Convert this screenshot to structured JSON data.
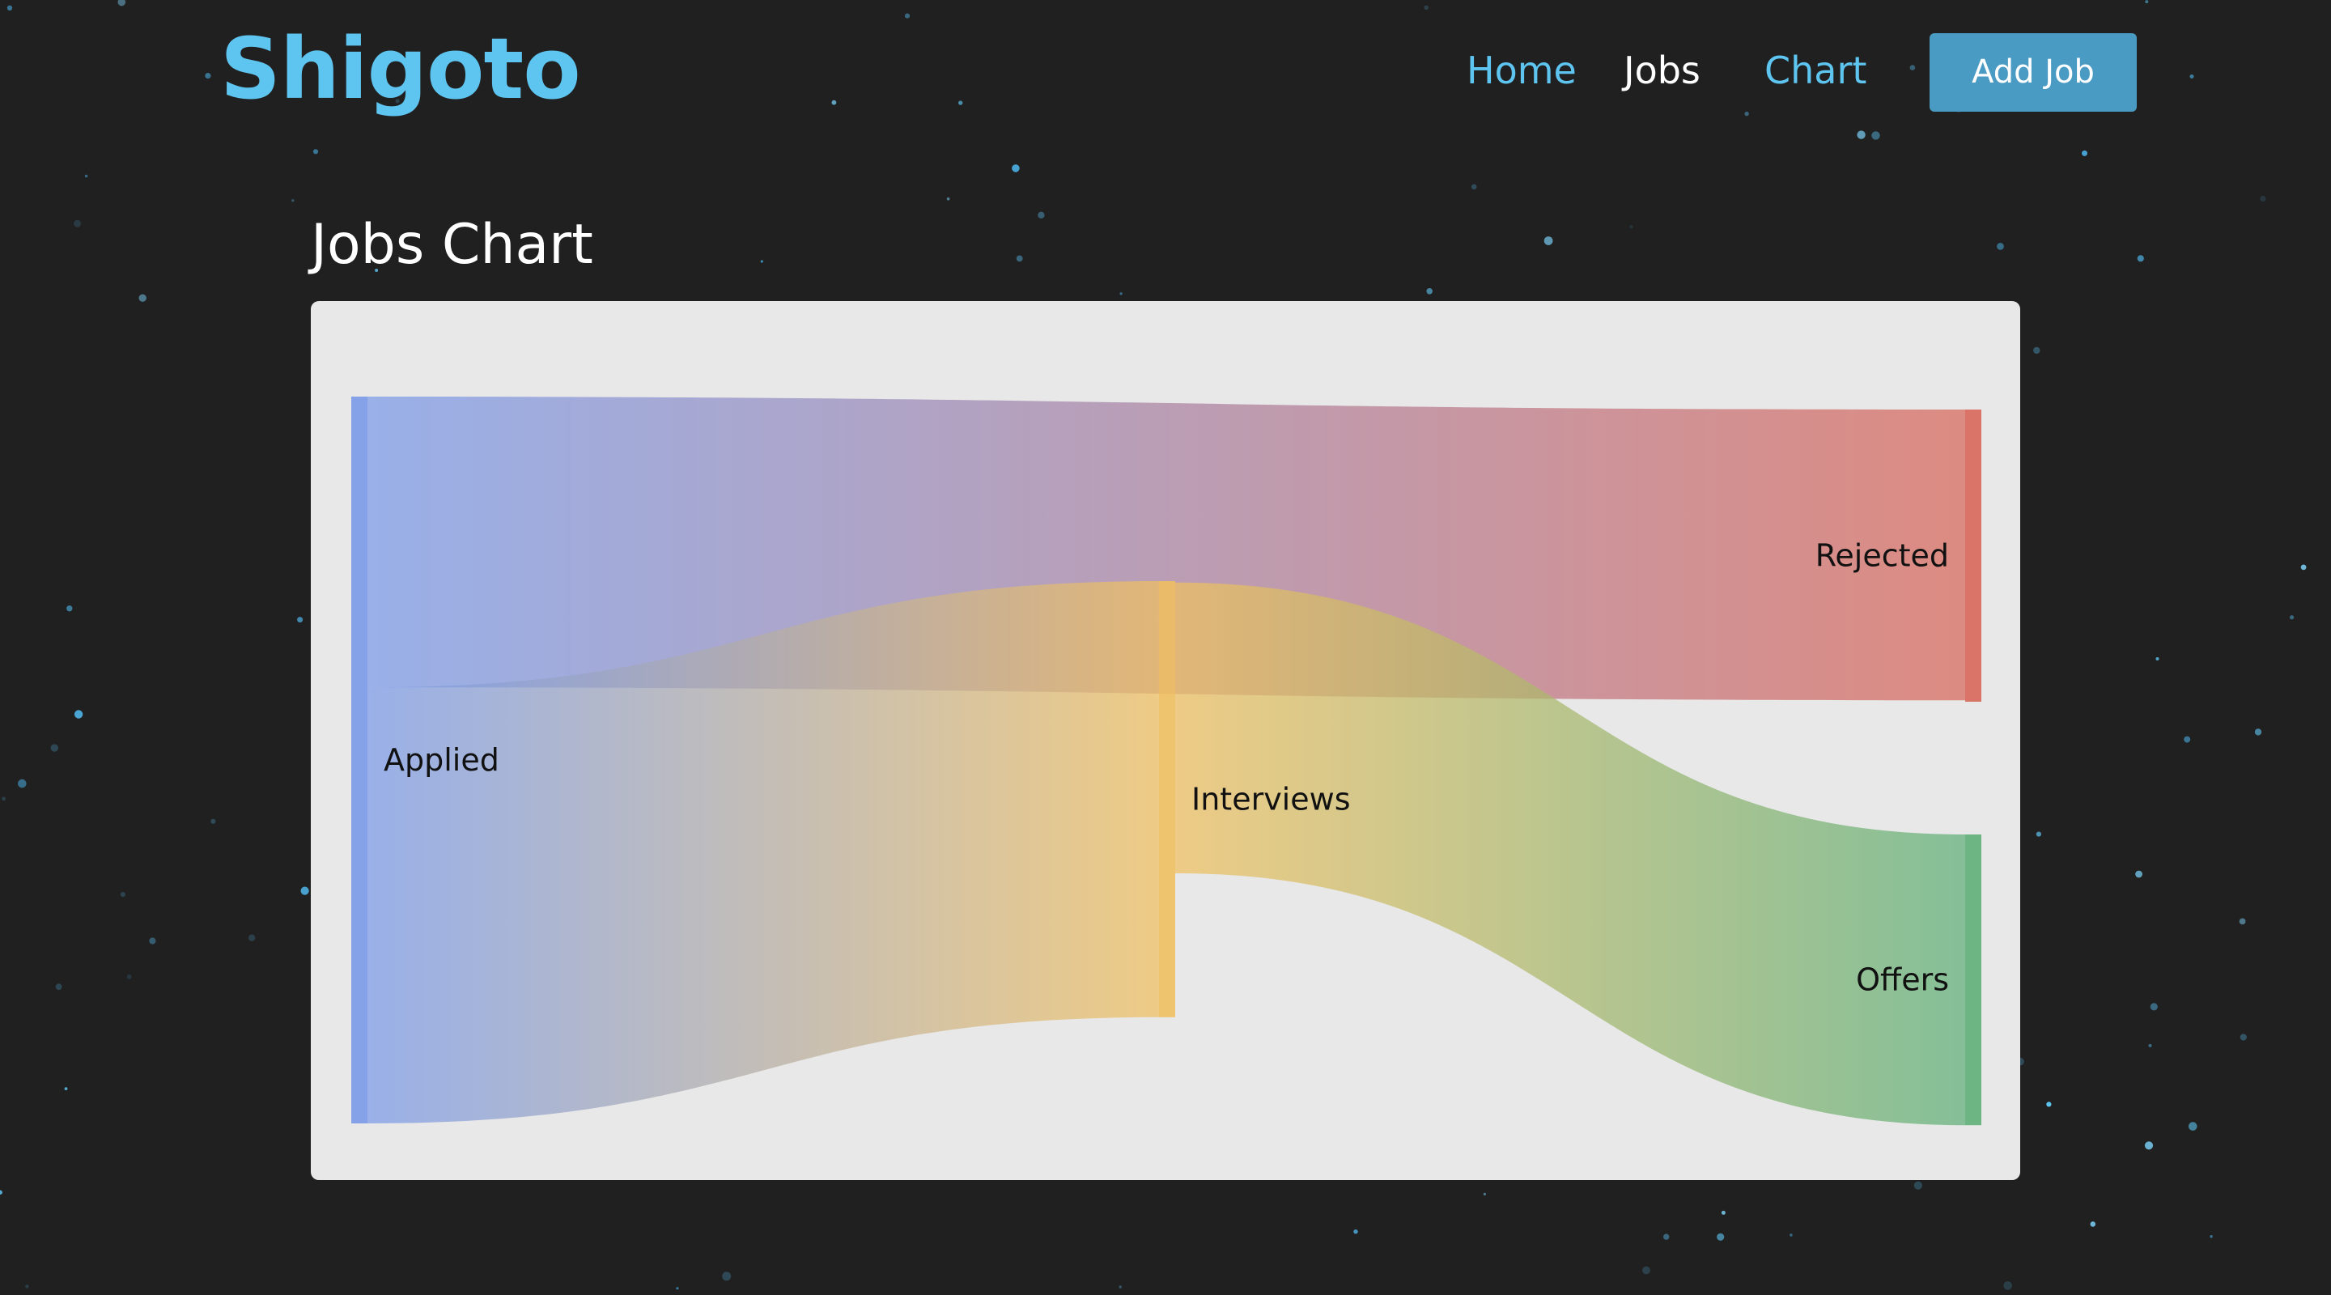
{
  "app": {
    "logo": "Shigoto"
  },
  "nav": {
    "home": "Home",
    "jobs": "Jobs",
    "chart": "Chart",
    "add_job": "Add Job"
  },
  "page": {
    "title": "Jobs Chart"
  },
  "colors": {
    "background": "#202020",
    "accent": "#5ec4f0",
    "button": "#4a9bc4",
    "card": "#e8e8e8",
    "applied": "#7a9ae8",
    "interviews": "#f0c060",
    "rejected": "#d8675a",
    "offers": "#5faf78"
  },
  "chart_data": {
    "type": "sankey",
    "title": "",
    "nodes": [
      {
        "id": "applied",
        "name": "Applied",
        "color": "#7a9ae8",
        "column": 0
      },
      {
        "id": "interviews",
        "name": "Interviews",
        "color": "#f0c060",
        "column": 1
      },
      {
        "id": "rejected",
        "name": "Rejected",
        "color": "#d8675a",
        "column": 2
      },
      {
        "id": "offers",
        "name": "Offers",
        "color": "#5faf78",
        "column": 2
      }
    ],
    "links": [
      {
        "source": "applied",
        "target": "rejected",
        "value": 2
      },
      {
        "source": "applied",
        "target": "interviews",
        "value": 3
      },
      {
        "source": "interviews",
        "target": "offers",
        "value": 2
      },
      {
        "source": "interviews",
        "target": "rejected",
        "value": 0.01
      }
    ]
  }
}
